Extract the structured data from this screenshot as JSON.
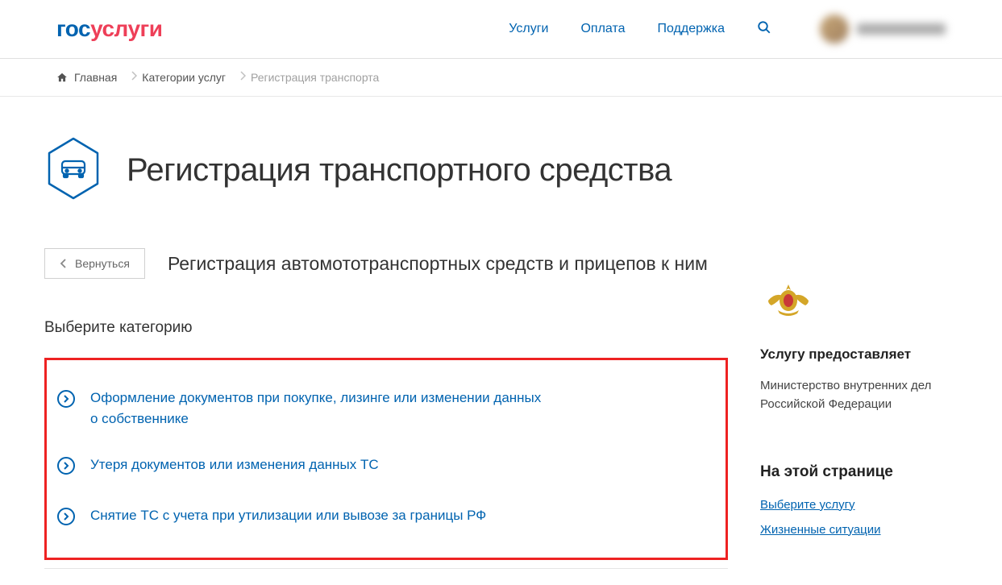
{
  "logo": {
    "part1": "гос",
    "part2": "услуги"
  },
  "nav": {
    "services": "Услуги",
    "payment": "Оплата",
    "support": "Поддержка"
  },
  "breadcrumbs": {
    "home": "Главная",
    "categories": "Категории услуг",
    "current": "Регистрация транспорта"
  },
  "page": {
    "title": "Регистрация транспортного средства",
    "subtitle": "Регистрация автомототранспортных средств и прицепов к ним",
    "back": "Вернуться",
    "select_label": "Выберите категорию"
  },
  "categories": [
    {
      "text": "Оформление документов при покупке, лизинге или изменении данных о собственнике"
    },
    {
      "text": "Утеря документов или изменения данных ТС"
    },
    {
      "text": "Снятие ТС с учета при утилизации или вывозе за границы РФ"
    }
  ],
  "sidebar": {
    "provider_title": "Услугу предоставляет",
    "provider_text": "Министерство внутренних дел Российской Федерации",
    "onpage_title": "На этой странице",
    "links": {
      "select": "Выберите услугу",
      "situations": "Жизненные ситуации"
    }
  }
}
